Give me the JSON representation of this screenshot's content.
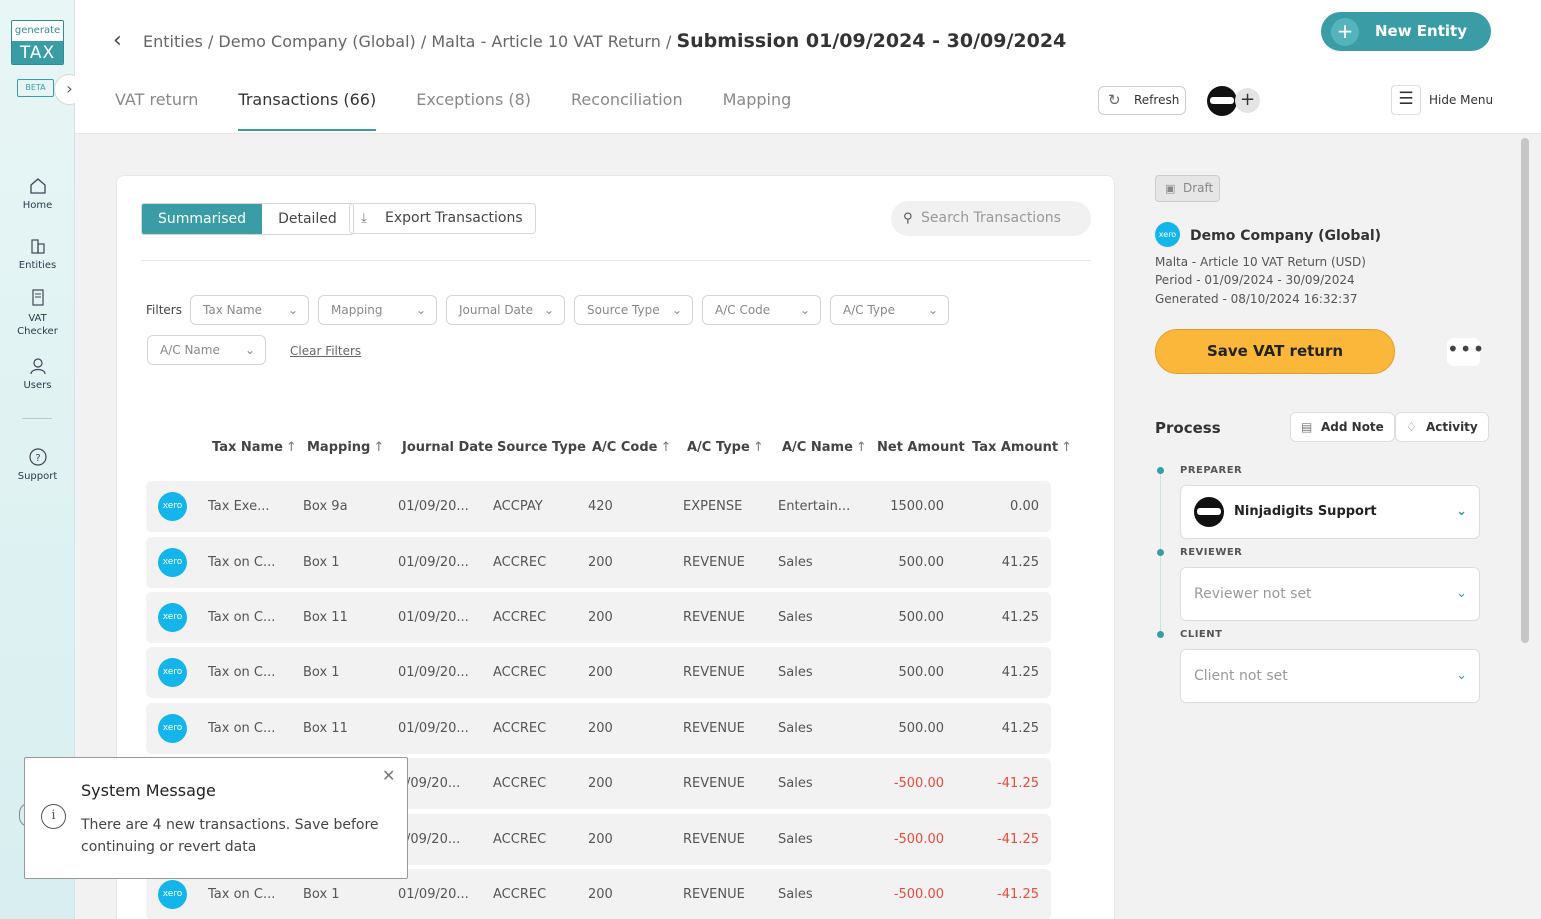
{
  "logo": {
    "top": "generate",
    "bottom": "TAX",
    "badge": "BETA"
  },
  "nav": [
    {
      "label": "Home",
      "icon": "home-icon"
    },
    {
      "label": "Entities",
      "icon": "building-icon"
    },
    {
      "label": "VAT Checker",
      "icon": "document-icon"
    },
    {
      "label": "Users",
      "icon": "user-icon"
    },
    {
      "label": "Support",
      "icon": "help-icon"
    }
  ],
  "header": {
    "breadcrumb": "Entities / Demo Company (Global) / Malta - Article 10 VAT Return /",
    "current": "Submission 01/09/2024 - 30/09/2024",
    "new_entity": "New Entity",
    "tabs": [
      "VAT return",
      "Transactions (66)",
      "Exceptions (8)",
      "Reconciliation",
      "Mapping"
    ],
    "active_tab": "Transactions (66)",
    "refresh": "Refresh",
    "hide_menu": "Hide Menu"
  },
  "toolbar": {
    "summarised": "Summarised",
    "detailed": "Detailed",
    "export": "Export Transactions",
    "search_placeholder": "Search Transactions"
  },
  "filters": {
    "label": "Filters",
    "items": [
      "Tax Name",
      "Mapping",
      "Journal Date",
      "Source Type",
      "A/C Code",
      "A/C Type",
      "A/C Name"
    ],
    "clear": "Clear Filters"
  },
  "table": {
    "columns": [
      "Tax Name",
      "Mapping",
      "Journal Date",
      "Source Type",
      "A/C Code",
      "A/C Type",
      "A/C Name",
      "Net Amount",
      "Tax Amount"
    ],
    "rows": [
      {
        "tax_name": "Tax Exe...",
        "mapping": "Box 9a",
        "date": "01/09/20...",
        "source": "ACCPAY",
        "code": "420",
        "type": "EXPENSE",
        "name": "Entertain...",
        "net": "1500.00",
        "tax": "0.00"
      },
      {
        "tax_name": "Tax on C...",
        "mapping": "Box 1",
        "date": "01/09/20...",
        "source": "ACCREC",
        "code": "200",
        "type": "REVENUE",
        "name": "Sales",
        "net": "500.00",
        "tax": "41.25"
      },
      {
        "tax_name": "Tax on C...",
        "mapping": "Box 11",
        "date": "01/09/20...",
        "source": "ACCREC",
        "code": "200",
        "type": "REVENUE",
        "name": "Sales",
        "net": "500.00",
        "tax": "41.25"
      },
      {
        "tax_name": "Tax on C...",
        "mapping": "Box 1",
        "date": "01/09/20...",
        "source": "ACCREC",
        "code": "200",
        "type": "REVENUE",
        "name": "Sales",
        "net": "500.00",
        "tax": "41.25"
      },
      {
        "tax_name": "Tax on C...",
        "mapping": "Box 11",
        "date": "01/09/20...",
        "source": "ACCREC",
        "code": "200",
        "type": "REVENUE",
        "name": "Sales",
        "net": "500.00",
        "tax": "41.25"
      },
      {
        "tax_name": "",
        "mapping": "",
        "date": "/09/20...",
        "source": "ACCREC",
        "code": "200",
        "type": "REVENUE",
        "name": "Sales",
        "net": "-500.00",
        "tax": "-41.25"
      },
      {
        "tax_name": "",
        "mapping": "",
        "date": "/09/20...",
        "source": "ACCREC",
        "code": "200",
        "type": "REVENUE",
        "name": "Sales",
        "net": "-500.00",
        "tax": "-41.25"
      },
      {
        "tax_name": "Tax on C...",
        "mapping": "Box 1",
        "date": "01/09/20...",
        "source": "ACCREC",
        "code": "200",
        "type": "REVENUE",
        "name": "Sales",
        "net": "-500.00",
        "tax": "-41.25"
      }
    ]
  },
  "panel": {
    "status": "Draft",
    "company": "Demo Company (Global)",
    "return_name": "Malta - Article 10 VAT Return (USD)",
    "period": "Period - 01/09/2024 - 30/09/2024",
    "generated": "Generated - 08/10/2024 16:32:37",
    "save": "Save VAT return",
    "process": "Process",
    "add_note": "Add Note",
    "activity": "Activity",
    "preparer_label": "PREPARER",
    "preparer": "Ninjadigits Support",
    "reviewer_label": "REVIEWER",
    "reviewer": "Reviewer not set",
    "client_label": "CLIENT",
    "client": "Client not set"
  },
  "toast": {
    "title": "System Message",
    "body": "There are 4 new transactions. Save before continuing or revert data"
  },
  "colors": {
    "accent": "#3a9ca5",
    "save": "#fbb73a",
    "negative": "#e74c3c",
    "xero": "#13b5ea"
  }
}
